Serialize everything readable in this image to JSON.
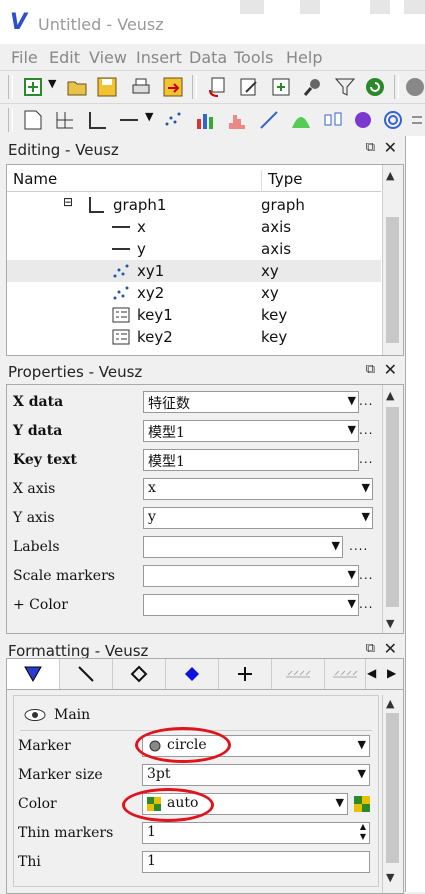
{
  "window": {
    "title": "Untitled - Veusz",
    "logo": "V"
  },
  "menu": [
    "File",
    "Edit",
    "View",
    "Insert",
    "Data",
    "Tools",
    "Help"
  ],
  "editing": {
    "title": "Editing - Veusz",
    "columns": [
      "Name",
      "Type"
    ],
    "rows": [
      {
        "name": "graph1",
        "type": "graph",
        "icon": "graph-icon"
      },
      {
        "name": "x",
        "type": "axis",
        "icon": "axis-icon"
      },
      {
        "name": "y",
        "type": "axis",
        "icon": "axis-icon"
      },
      {
        "name": "xy1",
        "type": "xy",
        "icon": "xy-icon"
      },
      {
        "name": "xy2",
        "type": "xy",
        "icon": "xy-icon"
      },
      {
        "name": "key1",
        "type": "key",
        "icon": "key-icon"
      },
      {
        "name": "key2",
        "type": "key",
        "icon": "key-icon"
      }
    ]
  },
  "properties": {
    "title": "Properties - Veusz",
    "rows": [
      {
        "label": "X data",
        "value": "特征数"
      },
      {
        "label": "Y data",
        "value": "模型1"
      },
      {
        "label": "Key text",
        "value": "模型1"
      },
      {
        "label": "X axis",
        "value": "x"
      },
      {
        "label": "Y axis",
        "value": "y"
      },
      {
        "label": "Labels",
        "value": ""
      },
      {
        "label": "Scale markers",
        "value": ""
      },
      {
        "label": "+ Color",
        "value": ""
      },
      {
        "label": "",
        "value": ""
      }
    ],
    "dots": "..."
  },
  "formatting": {
    "title": "Formatting - Veusz",
    "section": "Main",
    "rows": [
      {
        "label": "Marker",
        "value": "circle"
      },
      {
        "label": "Marker size",
        "value": "3pt"
      },
      {
        "label": "Color",
        "value": "auto"
      },
      {
        "label": "Thin markers",
        "value": "1"
      },
      {
        "label": "Thi",
        "value": "1"
      }
    ]
  },
  "colors": {
    "accent": "#2b4fd0",
    "annotation": "#e0141c"
  }
}
